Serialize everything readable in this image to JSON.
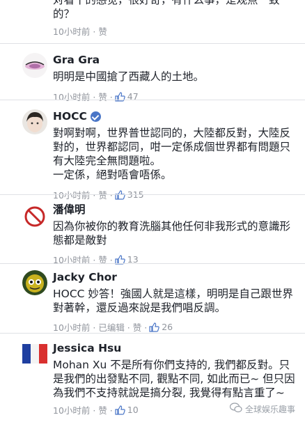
{
  "partial": {
    "text": "对看干的感觉，很好奇，有什么事，是观点一致的？",
    "meta": "10小时前 · 赞"
  },
  "comments": [
    {
      "name": "Gra Gra",
      "text": "明明是中國搶了西藏人的土地。",
      "meta": "10小时前 · 赞 ·",
      "likes": "47"
    },
    {
      "name": "HOCC",
      "text": "對啊對啊，世界普世認同的，大陸都反對，大陸反對的，世界都認同，咁一定係成個世界都有問題只有大陸完全無問題啦。\n一定係，絕對唔會唔係。",
      "meta": "10小时前 · 赞 ·",
      "likes": "315"
    },
    {
      "name": "潘偉明",
      "text": "因為你被你的教育洗腦其他任何非我形式的意識形態都是敵對",
      "meta": "10小时前 · 赞 ·",
      "likes": "13"
    },
    {
      "name": "Jacky Chor",
      "text": "HOCC 妙答！強國人就是這樣，明明是自己跟世界對著幹，還反過來說是我們唱反調。",
      "meta": "10小时前 · 已编辑 · 赞 ·",
      "likes": "26"
    },
    {
      "name": "Jessica Hsu",
      "text": "Mohan Xu 不是所有你們支持的, 我們都反對。只是我們的出發點不同, 觀點不同, 如此而已~ 但只因為我們不支持就說是搞分裂, 我覺得有點言重了~",
      "meta": "10小时前 · 赞 ·",
      "likes": "10"
    }
  ],
  "watermark": "全球娱乐趣事",
  "colors": {
    "meta": "#90949c",
    "verified": "#4a76c7",
    "separator": "#dfe1e5"
  }
}
